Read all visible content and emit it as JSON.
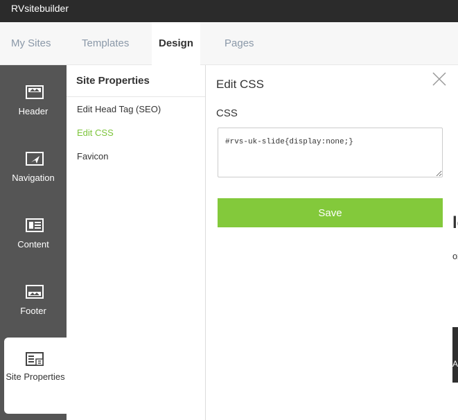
{
  "app": {
    "title": "RVsitebuilder"
  },
  "tabs": [
    {
      "label": "My Sites"
    },
    {
      "label": "Templates"
    },
    {
      "label": "Design"
    },
    {
      "label": "Pages"
    }
  ],
  "sidebar": {
    "items": [
      {
        "label": "Header",
        "icon": "header-icon"
      },
      {
        "label": "Navigation",
        "icon": "navigation-icon"
      },
      {
        "label": "Content",
        "icon": "content-icon"
      },
      {
        "label": "Footer",
        "icon": "footer-icon"
      },
      {
        "label": "Site Properties",
        "icon": "site-properties-icon",
        "active": true
      }
    ]
  },
  "subpanel": {
    "heading": "Site Properties",
    "items": [
      {
        "label": "Edit Head Tag (SEO)"
      },
      {
        "label": "Edit CSS",
        "active": true
      },
      {
        "label": "Favicon"
      }
    ]
  },
  "editor": {
    "title": "Edit CSS",
    "css_label": "CSS",
    "css_value": "#rvs-uk-slide{display:none;}",
    "save_label": "Save"
  },
  "peek": {
    "big": "le",
    "small": "ox",
    "dark": "A"
  },
  "colors": {
    "accent": "#83c93b",
    "active_link": "#7cc43a",
    "sidebar": "#555555",
    "appbar": "#2b2b2b"
  }
}
